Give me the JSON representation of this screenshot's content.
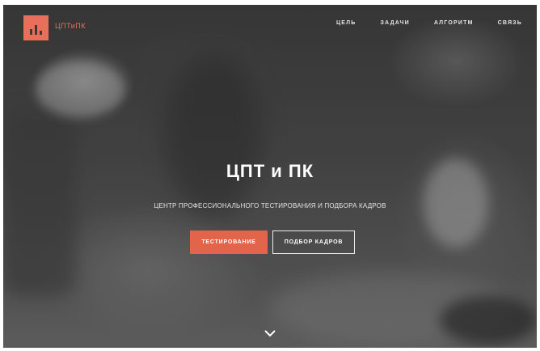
{
  "brand": {
    "name": "ЦПТиПК"
  },
  "nav": {
    "items": [
      "ЦЕЛЬ",
      "ЗАДАЧИ",
      "АЛГОРИТМ",
      "СВЯЗЬ"
    ]
  },
  "hero": {
    "title": "ЦПТ и ПК",
    "subtitle": "ЦЕНТР ПРОФЕССИОНАЛЬНОГО ТЕСТИРОВАНИЯ И ПОДБОРА КАДРОВ",
    "primary_button": "ТЕСТИРОВАНИЕ",
    "secondary_button": "ПОДБОР КАДРОВ",
    "scroll_icon": "chevron-down-icon"
  },
  "colors": {
    "accent": "#e2654b",
    "text": "#ffffff"
  }
}
